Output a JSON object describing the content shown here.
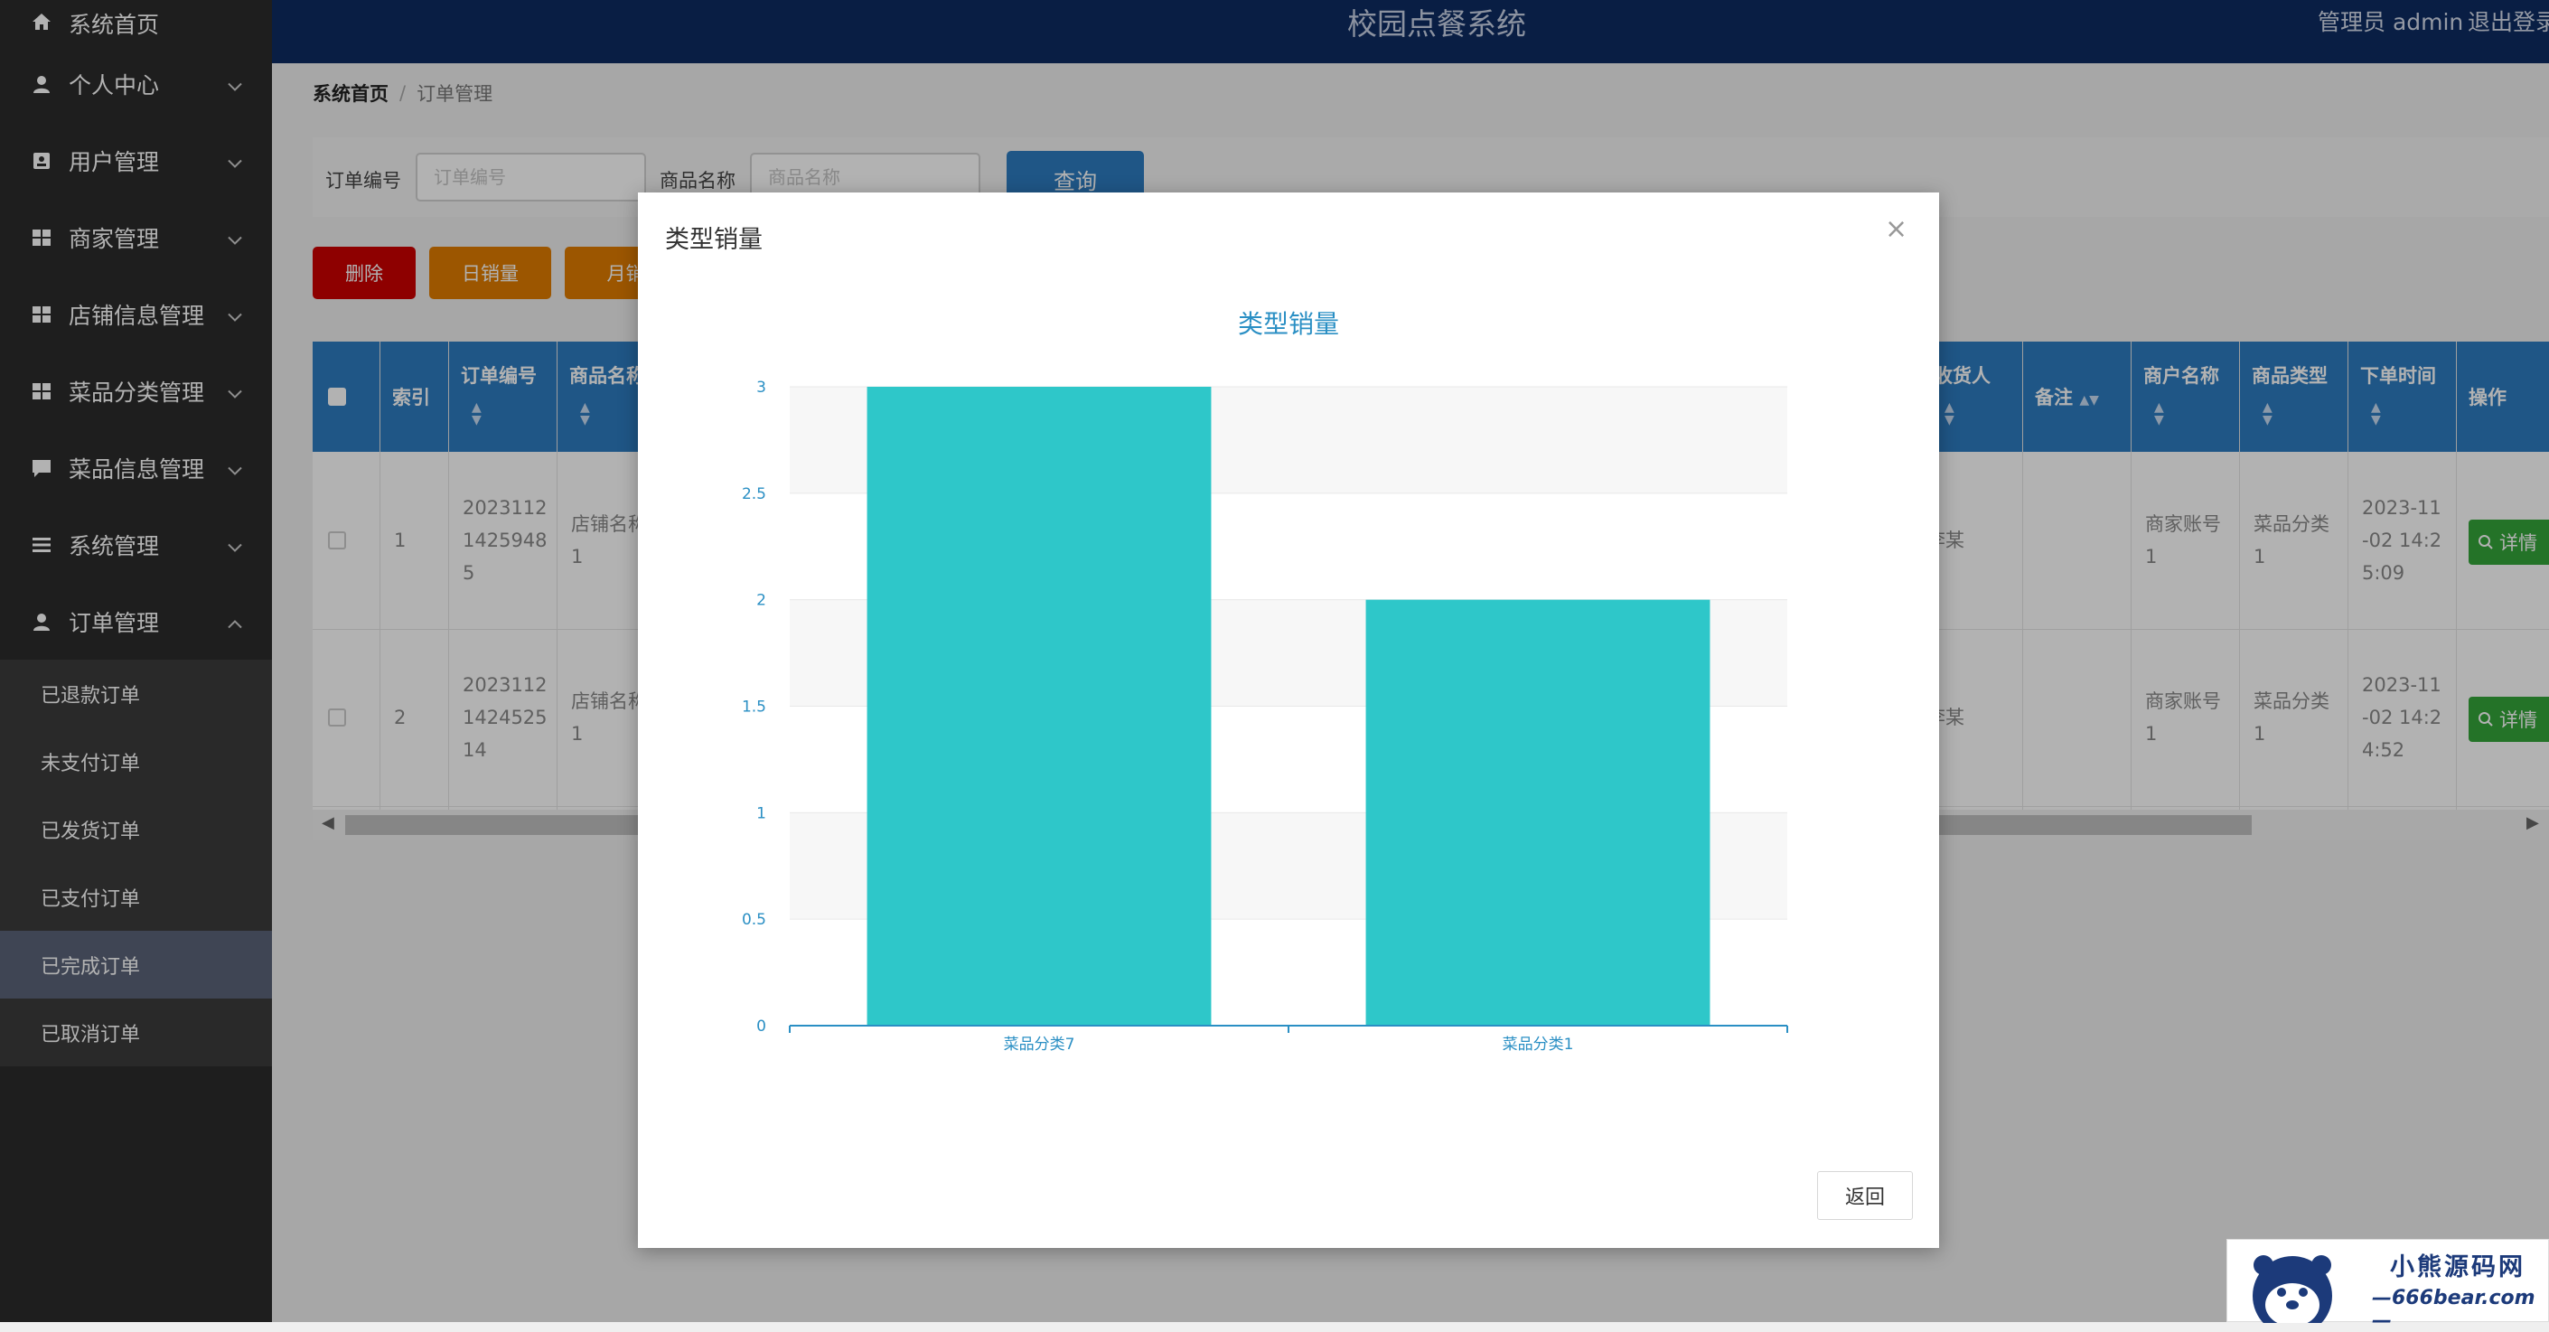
{
  "app": {
    "title": "校园点餐系统",
    "user_label": "管理员 admin",
    "logout_label": "退出登录"
  },
  "sidebar": {
    "items": [
      {
        "label": "系统首页",
        "icon": "home-icon",
        "has_chevron": false
      },
      {
        "label": "个人中心",
        "icon": "user-icon",
        "has_chevron": true
      },
      {
        "label": "用户管理",
        "icon": "id-card-icon",
        "has_chevron": true
      },
      {
        "label": "商家管理",
        "icon": "grid-icon",
        "has_chevron": true
      },
      {
        "label": "店铺信息管理",
        "icon": "grid-icon",
        "has_chevron": true
      },
      {
        "label": "菜品分类管理",
        "icon": "grid-icon",
        "has_chevron": true
      },
      {
        "label": "菜品信息管理",
        "icon": "comment-icon",
        "has_chevron": true
      },
      {
        "label": "系统管理",
        "icon": "list-icon",
        "has_chevron": true
      },
      {
        "label": "订单管理",
        "icon": "user-icon",
        "has_chevron": true,
        "expanded": true
      }
    ],
    "submenu": [
      {
        "label": "已退款订单",
        "active": false
      },
      {
        "label": "未支付订单",
        "active": false
      },
      {
        "label": "已发货订单",
        "active": false
      },
      {
        "label": "已支付订单",
        "active": false
      },
      {
        "label": "已完成订单",
        "active": true
      },
      {
        "label": "已取消订单",
        "active": false
      }
    ]
  },
  "breadcrumb": {
    "home": "系统首页",
    "separator": "/",
    "current": "订单管理"
  },
  "search": {
    "order_no_label": "订单编号",
    "order_no_placeholder": "订单编号",
    "product_label": "商品名称",
    "product_placeholder": "商品名称",
    "query_label": "查询"
  },
  "actions": {
    "delete_label": "删除",
    "daily_label": "日销量",
    "monthly_label": "月销"
  },
  "colors": {
    "header_bg": "#0d2b62",
    "sidebar_bg": "#2b2b2b",
    "primary": "#2d7cc1",
    "danger": "#cc0000",
    "warning": "#e07b00",
    "success": "#34a53a",
    "bar": "#2ec7c9"
  },
  "table": {
    "headers": {
      "index": "索引",
      "order_no": "订单编号",
      "product_name": "商品名称",
      "receiver": "收货人",
      "remark": "备注",
      "merchant_name": "商户名称",
      "product_type": "商品类型",
      "order_time": "下单时间",
      "operation": "操作"
    },
    "rows": [
      {
        "index": "1",
        "order_no": [
          "2023112",
          "1425948",
          "5"
        ],
        "product_name": [
          "店铺名称",
          "1"
        ],
        "receiver": "李某",
        "merchant_name": [
          "商家账号",
          "1"
        ],
        "product_type": [
          "菜品分类",
          "1"
        ],
        "order_time": [
          "2023-11",
          "-02 14:2",
          "5:09"
        ],
        "detail_label": "详情"
      },
      {
        "index": "2",
        "order_no": [
          "2023112",
          "1424525",
          "14"
        ],
        "product_name": [
          "店铺名称",
          "1"
        ],
        "receiver": "李某",
        "merchant_name": [
          "商家账号",
          "1"
        ],
        "product_type": [
          "菜品分类",
          "1"
        ],
        "order_time": [
          "2023-11",
          "-02 14:2",
          "4:52"
        ],
        "detail_label": "详情"
      }
    ]
  },
  "modal": {
    "title": "类型销量",
    "close_symbol": "×",
    "return_label": "返回"
  },
  "chart_data": {
    "type": "bar",
    "title": "类型销量",
    "categories": [
      "菜品分类7",
      "菜品分类1"
    ],
    "values": [
      3,
      2
    ],
    "xlabel": "",
    "ylabel": "",
    "ylim": [
      0,
      3
    ],
    "yticks": [
      "0",
      "0.5",
      "1",
      "1.5",
      "2",
      "2.5",
      "3"
    ],
    "grid": true,
    "legend": "none"
  },
  "watermark": {
    "name": "小熊源码网",
    "url": "—666bear.com—"
  }
}
